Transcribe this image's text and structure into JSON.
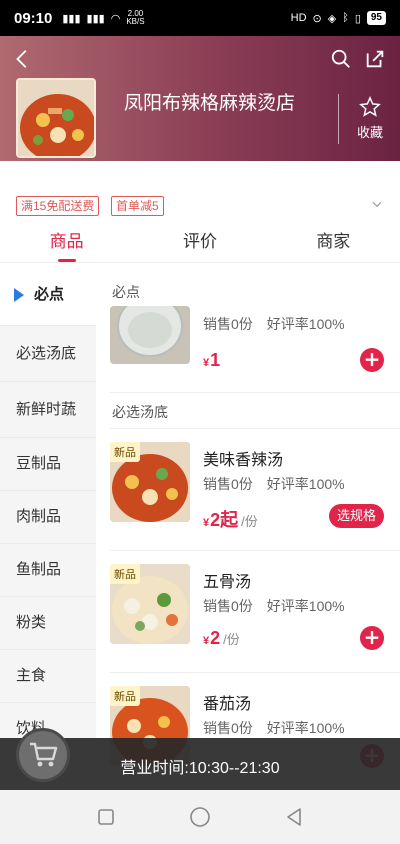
{
  "status_bar": {
    "time": "09:10",
    "signal1": "5G",
    "signal2": "4G",
    "speed": "2.00\nKB/S",
    "right_label": "HD",
    "battery": "95"
  },
  "header": {
    "store_name": "凤阳布辣格麻辣烫店",
    "fav_label": "收藏"
  },
  "promos": [
    "满15免配送费",
    "首单减5"
  ],
  "tabs": [
    "商品",
    "评价",
    "商家"
  ],
  "sidebar": {
    "items": [
      {
        "label": "必点"
      },
      {
        "label": "必选汤底"
      },
      {
        "label": "新鲜时蔬"
      },
      {
        "label": "豆制品"
      },
      {
        "label": "肉制品"
      },
      {
        "label": "鱼制品"
      },
      {
        "label": "粉类"
      },
      {
        "label": "主食"
      },
      {
        "label": "饮料"
      }
    ]
  },
  "main": {
    "section1": "必点",
    "section2": "必选汤底",
    "items": [
      {
        "name": "",
        "sales": "销售0份",
        "rating": "好评率100%",
        "price": "1",
        "unit": "",
        "badge": "",
        "action": "+"
      },
      {
        "name": "美味香辣汤",
        "sales": "销售0份",
        "rating": "好评率100%",
        "price": "2起",
        "unit": "/份",
        "badge": "新品",
        "action": "选规格"
      },
      {
        "name": "五骨汤",
        "sales": "销售0份",
        "rating": "好评率100%",
        "price": "2",
        "unit": "/份",
        "badge": "新品",
        "action": "+"
      },
      {
        "name": "番茄汤",
        "sales": "销售0份",
        "rating": "好评率100%",
        "price": "",
        "unit": "",
        "badge": "新品",
        "action": "+"
      }
    ],
    "currency": "¥"
  },
  "bottom": {
    "hours": "营业时间:10:30--21:30"
  },
  "colors": {
    "accent": "#e0244a",
    "header_start": "#b06a70",
    "header_end": "#6b2342",
    "sidebar_marker": "#2a7be4"
  }
}
